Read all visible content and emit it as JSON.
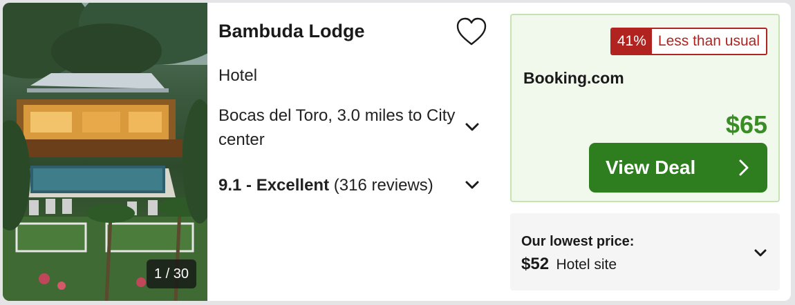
{
  "photo": {
    "counter": "1 / 30"
  },
  "hotel": {
    "name": "Bambuda Lodge",
    "type": "Hotel",
    "location": "Bocas del Toro, 3.0 miles to City center",
    "rating_score": "9.1 - Excellent",
    "rating_reviews": "(316 reviews)"
  },
  "deal": {
    "discount_pct": "41%",
    "discount_label": "Less than usual",
    "provider": "Booking.com",
    "price": "$65",
    "button_label": "View Deal"
  },
  "lowest": {
    "title": "Our lowest price:",
    "price": "$52",
    "source": "Hotel site"
  },
  "colors": {
    "accent_green": "#2e7d1f",
    "price_green": "#3a8c25",
    "discount_red": "#b0231f",
    "deal_bg": "#f1f8ec"
  },
  "icons": [
    "heart-icon",
    "chevron-down-icon",
    "chevron-right-icon"
  ]
}
